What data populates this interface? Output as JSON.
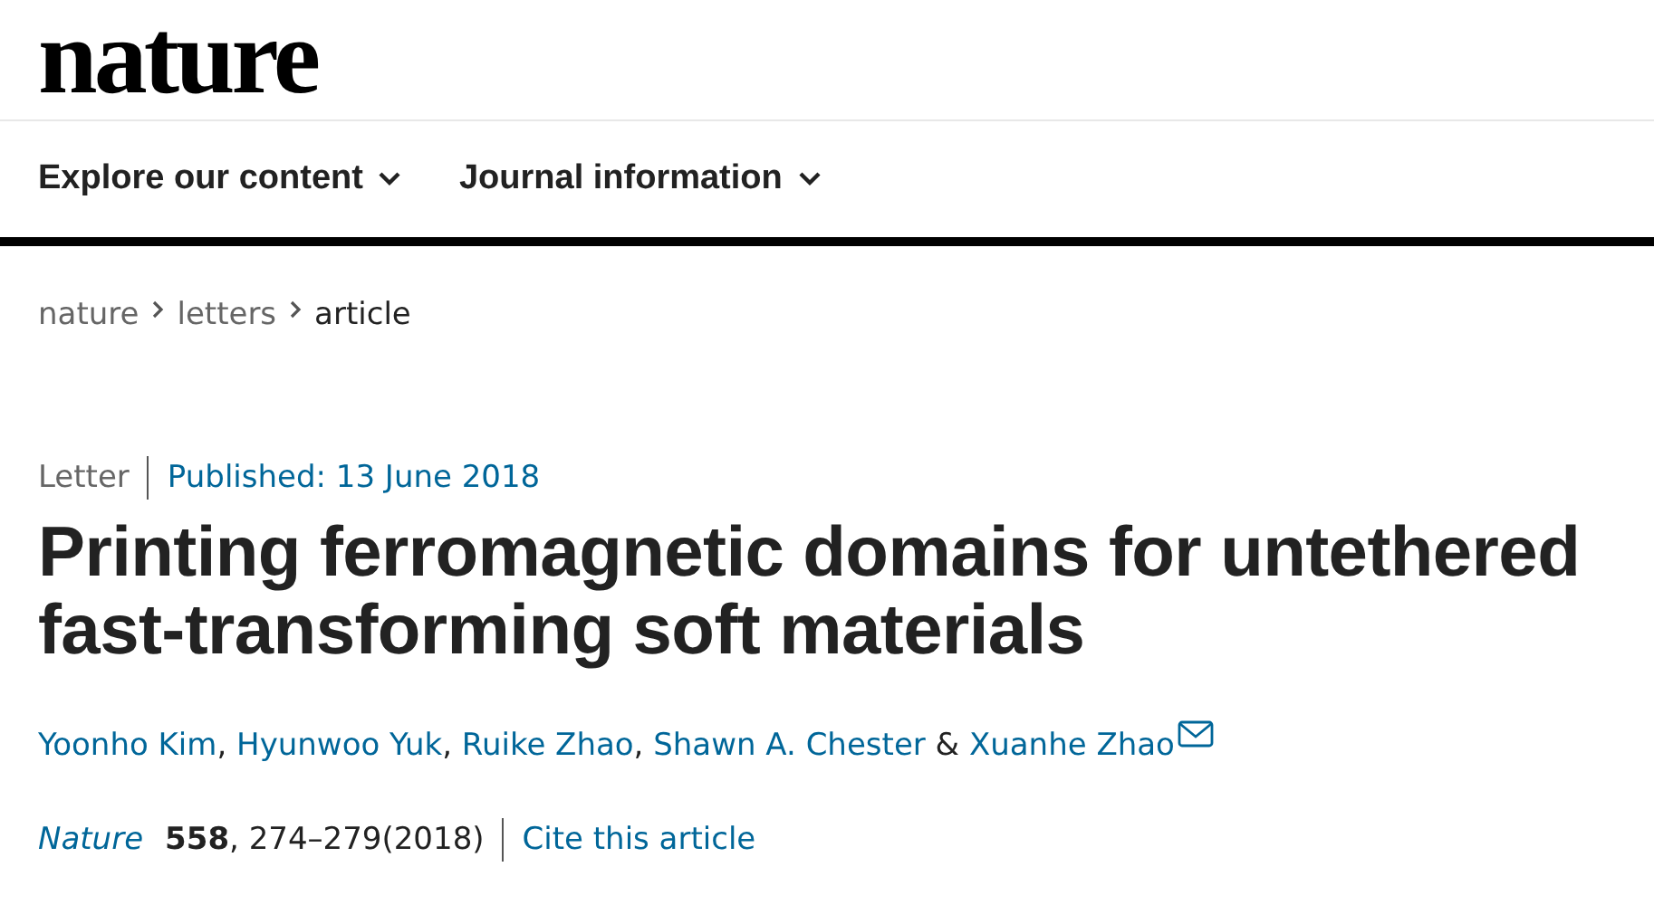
{
  "header": {
    "logo": "nature"
  },
  "nav": [
    {
      "label": "Explore our content",
      "has_menu": true
    },
    {
      "label": "Journal information",
      "has_menu": true
    }
  ],
  "breadcrumbs": [
    {
      "label": "nature",
      "current": false
    },
    {
      "label": "letters",
      "current": false
    },
    {
      "label": "article",
      "current": true
    }
  ],
  "article": {
    "type": "Letter",
    "published": "Published: 13 June 2018",
    "title": "Printing ferromagnetic domains for untethered fast-transforming soft materials",
    "authors": [
      {
        "name": "Yoonho Kim",
        "after": ","
      },
      {
        "name": "Hyunwoo Yuk",
        "after": ","
      },
      {
        "name": "Ruike Zhao",
        "after": ","
      },
      {
        "name": "Shawn A. Chester",
        "after": " &"
      },
      {
        "name": "Xuanhe Zhao",
        "corresponding": true
      }
    ],
    "journal": "Nature",
    "citation": "**558**, 274–279(2018)",
    "cite_link": "Cite this article"
  }
}
